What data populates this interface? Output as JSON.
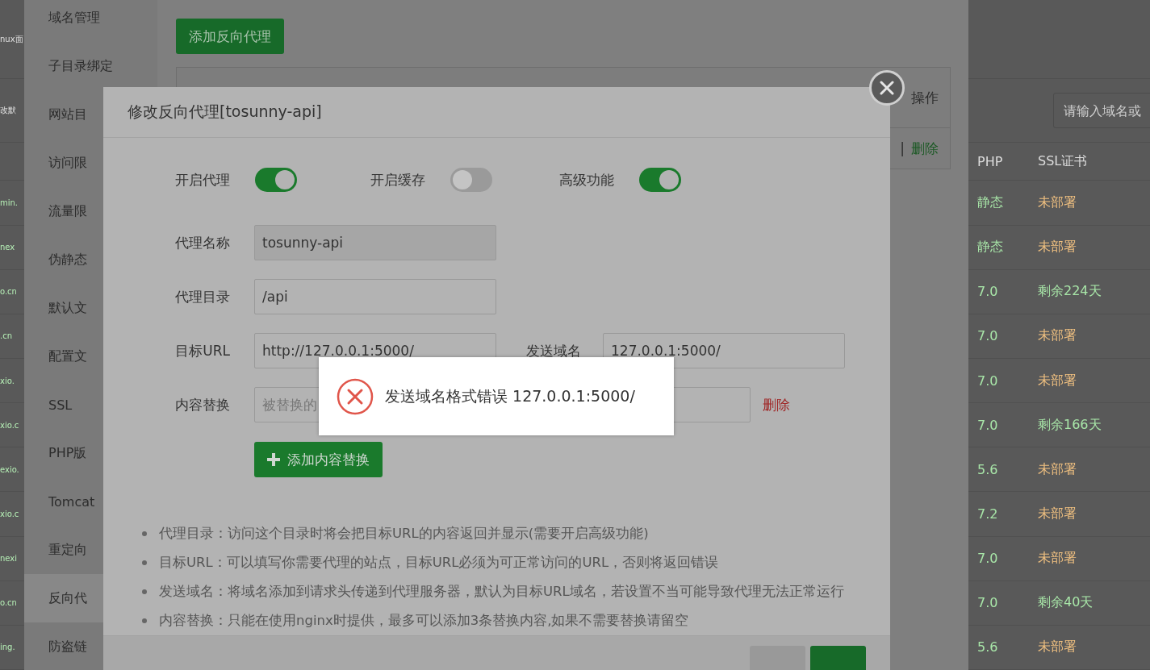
{
  "background": {
    "top_fragments": [
      "nux面",
      "改默"
    ],
    "search": {
      "placeholder": "请输入域名或"
    },
    "columns": [
      "PHP",
      "SSL证书"
    ],
    "rows": [
      {
        "column_1": "min.",
        "php": "静态",
        "ssl": "未部署",
        "color": "#f0c080"
      },
      {
        "column_1": "nex",
        "php": "静态",
        "ssl": "未部署",
        "color": "#f0c080"
      },
      {
        "column_1": "o.cn",
        "php": "7.0",
        "ssl": "剩余224天",
        "color": "#a8e6a8"
      },
      {
        "column_1": ".cn",
        "php": "7.0",
        "ssl": "未部署",
        "color": "#f0c080"
      },
      {
        "column_1": "xio.",
        "php": "7.0",
        "ssl": "未部署",
        "color": "#f0c080"
      },
      {
        "column_1": "xio.c",
        "php": "7.0",
        "ssl": "剩余166天",
        "color": "#a8e6a8"
      },
      {
        "column_1": "exio.",
        "php": "5.6",
        "ssl": "未部署",
        "color": "#f0c080"
      },
      {
        "column_1": "xio.c",
        "php": "7.2",
        "ssl": "未部署",
        "color": "#f0c080"
      },
      {
        "column_1": "nexi",
        "php": "7.0",
        "ssl": "未部署",
        "color": "#f0c080"
      },
      {
        "column_1": "o.cn",
        "php": "7.0",
        "ssl": "剩余40天",
        "color": "#a8e6a8"
      },
      {
        "column_1": "ing.",
        "php": "5.6",
        "ssl": "未部署",
        "color": "#f0c080"
      }
    ]
  },
  "panel": {
    "sidebar": [
      {
        "label": "域名管理",
        "selected": false
      },
      {
        "label": "子目录绑定",
        "selected": false
      },
      {
        "label": "网站目",
        "selected": false
      },
      {
        "label": "访问限",
        "selected": false
      },
      {
        "label": "流量限",
        "selected": false
      },
      {
        "label": "伪静态",
        "selected": false
      },
      {
        "label": "默认文",
        "selected": false
      },
      {
        "label": "配置文",
        "selected": false
      },
      {
        "label": "SSL",
        "selected": false
      },
      {
        "label": "PHP版",
        "selected": false
      },
      {
        "label": "Tomcat",
        "selected": false
      },
      {
        "label": "重定向",
        "selected": false
      },
      {
        "label": "反向代",
        "selected": true
      },
      {
        "label": "防盗链",
        "selected": false
      }
    ],
    "add_button": "添加反向代理",
    "table": {
      "header": "操作",
      "separator": "|",
      "action": "删除"
    }
  },
  "dialog": {
    "title": "修改反向代理[tosunny-api]",
    "toggles": [
      {
        "label": "开启代理",
        "on": true
      },
      {
        "label": "开启缓存",
        "on": false
      },
      {
        "label": "高级功能",
        "on": true
      }
    ],
    "rows": [
      {
        "kind": "single",
        "label": "代理名称",
        "value": "tosunny-api",
        "disabled": true
      },
      {
        "kind": "single",
        "label": "代理目录",
        "value": "/api",
        "disabled": false
      },
      {
        "kind": "pair",
        "label": "目标URL",
        "value": "http://127.0.0.1:5000/",
        "label_2": "发送域名",
        "value_2": "127.0.0.1:5000/"
      },
      {
        "kind": "replace",
        "label": "内容替换",
        "placeholder": "被替换的",
        "delete": "删除"
      }
    ],
    "add_replace_button": "添加内容替换",
    "tips": [
      "代理目录：访问这个目录时将会把目标URL的内容返回并显示(需要开启高级功能)",
      "目标URL：可以填写你需要代理的站点，目标URL必须为可正常访问的URL，否则将返回错误",
      "发送域名：将域名添加到请求头传递到代理服务器，默认为目标URL域名，若设置不当可能导致代理无法正常运行",
      "内容替换：只能在使用nginx时提供，最多可以添加3条替换内容,如果不需要替换请留空"
    ]
  },
  "toast": {
    "message": "发送域名格式错误 127.0.0.1:5000/"
  }
}
